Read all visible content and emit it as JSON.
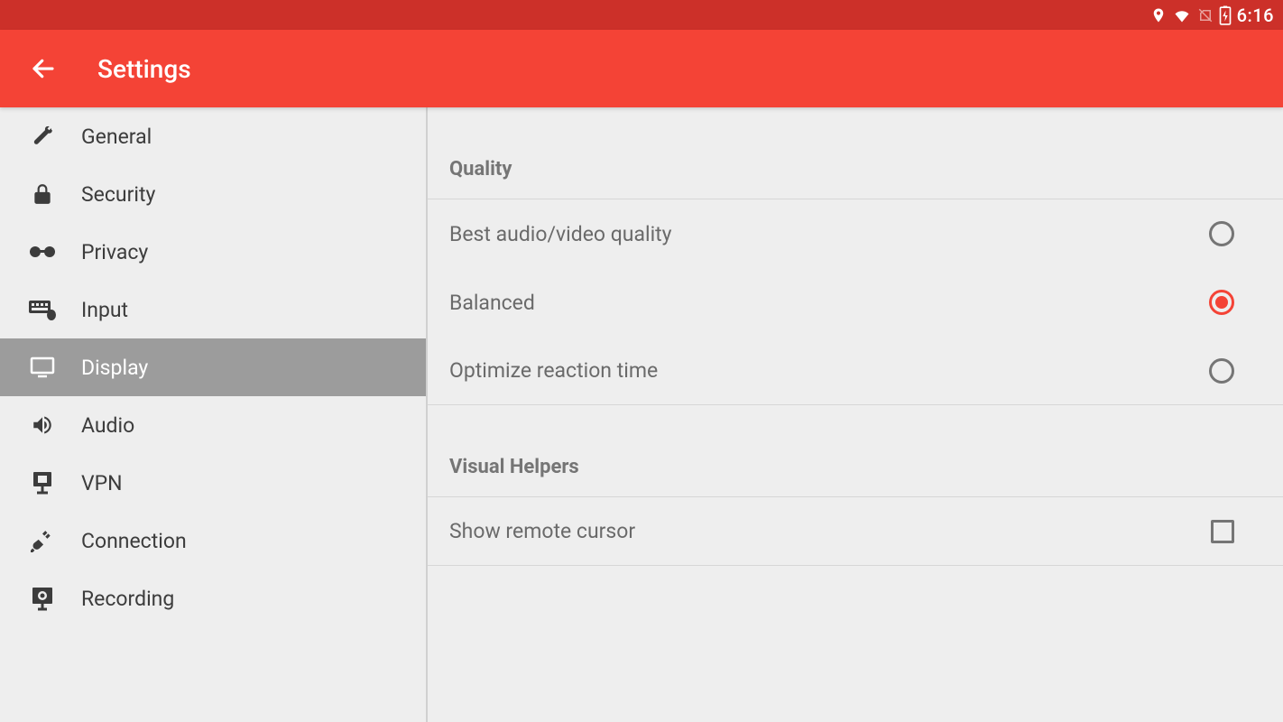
{
  "status_bar": {
    "time": "6:16"
  },
  "app_bar": {
    "title": "Settings"
  },
  "sidebar": {
    "items": [
      {
        "label": "General"
      },
      {
        "label": "Security"
      },
      {
        "label": "Privacy"
      },
      {
        "label": "Input"
      },
      {
        "label": "Display"
      },
      {
        "label": "Audio"
      },
      {
        "label": "VPN"
      },
      {
        "label": "Connection"
      },
      {
        "label": "Recording"
      }
    ],
    "selected_index": 4
  },
  "main": {
    "sections": [
      {
        "title": "Quality",
        "options": [
          {
            "label": "Best audio/video quality",
            "selected": false
          },
          {
            "label": "Balanced",
            "selected": true
          },
          {
            "label": "Optimize reaction time",
            "selected": false
          }
        ]
      },
      {
        "title": "Visual Helpers",
        "options": [
          {
            "label": "Show remote cursor",
            "checked": false
          }
        ]
      }
    ]
  }
}
